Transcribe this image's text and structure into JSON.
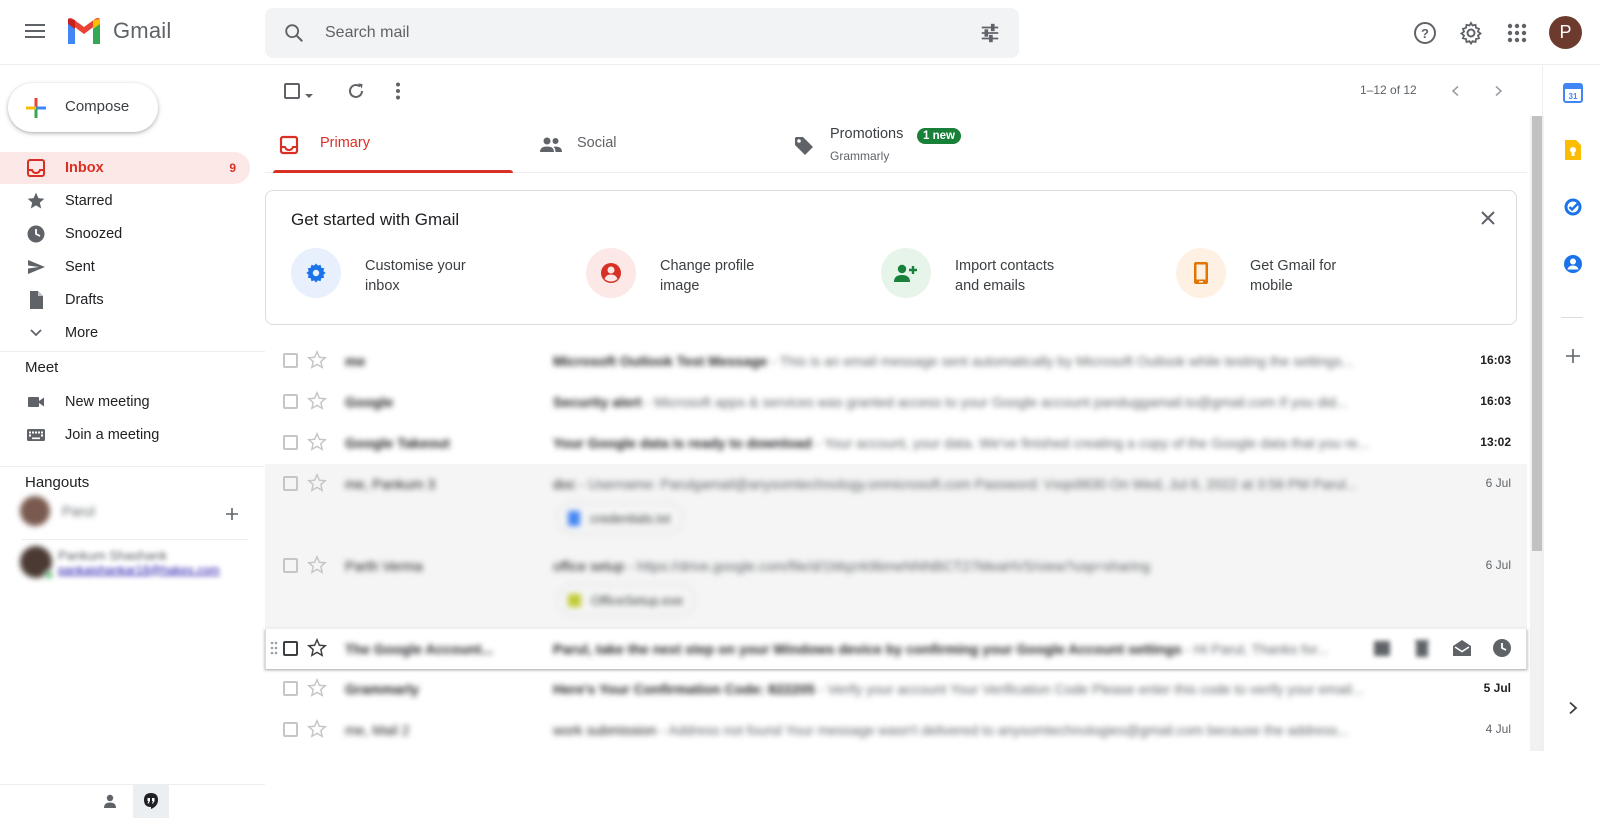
{
  "app": {
    "name": "Gmail",
    "avatar_letter": "P"
  },
  "search": {
    "placeholder": "Search mail"
  },
  "compose": {
    "label": "Compose"
  },
  "nav": [
    {
      "label": "Inbox",
      "count": "9",
      "icon": "inbox-icon",
      "active": true
    },
    {
      "label": "Starred",
      "icon": "star-icon"
    },
    {
      "label": "Snoozed",
      "icon": "clock-icon"
    },
    {
      "label": "Sent",
      "icon": "send-icon"
    },
    {
      "label": "Drafts",
      "icon": "draft-icon"
    },
    {
      "label": "More",
      "icon": "chevron-down-icon"
    }
  ],
  "meet": {
    "title": "Meet",
    "items": [
      {
        "label": "New meeting",
        "icon": "video-icon"
      },
      {
        "label": "Join a meeting",
        "icon": "keyboard-icon"
      }
    ]
  },
  "hangouts": {
    "title": "Hangouts",
    "user": "Parul",
    "contact_name": "Pankum Shashank",
    "contact_email": "pankajshankar18@hakes.com"
  },
  "toolbar": {
    "page_count": "1–12 of 12"
  },
  "tabs": [
    {
      "label": "Primary",
      "icon": "inbox-tab-icon",
      "active": true
    },
    {
      "label": "Social",
      "icon": "people-icon"
    },
    {
      "label": "Promotions",
      "icon": "tag-icon",
      "badge": "1 new",
      "sub": "Grammarly"
    }
  ],
  "get_started": {
    "title": "Get started with Gmail",
    "items": [
      {
        "label_line1": "Customise your",
        "label_line2": "inbox",
        "icon": "gear-icon",
        "color": "#1a73e8",
        "bg": "#e8f0fe"
      },
      {
        "label_line1": "Change profile",
        "label_line2": "image",
        "icon": "account-icon",
        "color": "#d93025",
        "bg": "#fce8e6"
      },
      {
        "label_line1": "Import contacts",
        "label_line2": "and emails",
        "icon": "person-add-icon",
        "color": "#188038",
        "bg": "#e6f4ea"
      },
      {
        "label_line1": "Get Gmail for",
        "label_line2": "mobile",
        "icon": "phone-icon",
        "color": "#e37400",
        "bg": "#fef1e3"
      }
    ]
  },
  "emails": [
    {
      "sender": "me",
      "subject": "Microsoft Outlook Test Message",
      "snippet": " - This is an email message sent automatically by Microsoft Outlook while testing the settings...",
      "date": "16:03",
      "unread": true
    },
    {
      "sender": "Google",
      "subject": "Security alert",
      "snippet": " - Microsoft apps & services was granted access to your Google account panduggamail.to@gmail.com If you did...",
      "date": "16:03",
      "unread": true
    },
    {
      "sender": "Google Takeout",
      "subject": "Your Google data is ready to download",
      "snippet": " - Your account, your data. We've finished creating a copy of the Google data that you re...",
      "date": "13:02",
      "unread": true
    },
    {
      "sender": "me, Pankum 3",
      "subject": "doc",
      "snippet": " - Username: Parulgamail@anysomtechnology.onmicrosoft.com Password: Vxqs9830 On Wed, Jul 6, 2022 at 3:56 PM Parul...",
      "date": "6 Jul",
      "unread": false,
      "attachment": "credentials.txt"
    },
    {
      "sender": "Parth Verma",
      "subject": "office setup",
      "snippet": " - https://drive.google.com/file/d/1Mqzrk9bmeNNNBCT27MeaHVS/view?usp=sharing",
      "date": "6 Jul",
      "unread": false,
      "attachment": "OfficeSetup.exe"
    },
    {
      "sender": "The Google Account...",
      "subject": "Parul, take the next step on your Windows device by confirming your Google Account settings",
      "snippet": " - Hi Parul, Thanks for...",
      "date": "",
      "unread": true,
      "hover": true
    },
    {
      "sender": "Grammarly",
      "subject": "Here's Your Confirmation Code: 822205",
      "snippet": " - Verify your account Your Verification Code Please enter this code to verify your email...",
      "date": "5 Jul",
      "unread": true
    },
    {
      "sender": "me, Mail 2",
      "subject": "work submission",
      "snippet": " - Address not found Your message wasn't delivered to anysomtechnologies@gmail.com because the address...",
      "date": "4 Jul",
      "unread": false
    }
  ],
  "colors": {
    "accent": "#d93025",
    "brand_blue": "#4285f4",
    "brand_green": "#34a853",
    "brand_yellow": "#fbbc04"
  }
}
